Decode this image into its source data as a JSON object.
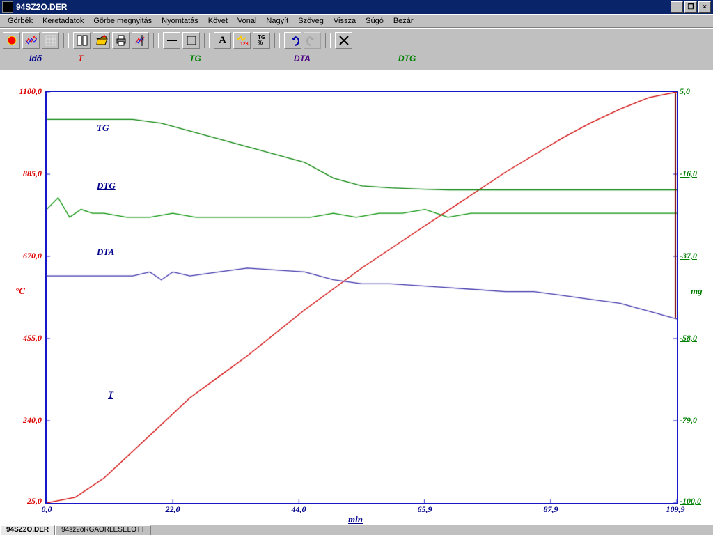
{
  "window": {
    "title": "94SZ2O.DER"
  },
  "menu": [
    "Görbék",
    "Keretadatok",
    "Görbe megnyitás",
    "Nyomtatás",
    "Követ",
    "Vonal",
    "Nagyít",
    "Szöveg",
    "Vissza",
    "Súgó",
    "Bezár"
  ],
  "series_header": {
    "ido": "Idő",
    "t": "T",
    "tg": "TG",
    "dta": "DTA",
    "dtg": "DTG"
  },
  "axis": {
    "left_label": "°C",
    "right_label": "mg",
    "bottom_label": "min",
    "left_ticks": [
      "1100,0",
      "885,0",
      "670,0",
      "455,0",
      "240,0",
      "25,0"
    ],
    "right_ticks": [
      "5,0",
      "-16,0",
      "-37,0",
      "-58,0",
      "-79,0",
      "-100,0"
    ],
    "bottom_ticks": [
      "0,0",
      "22,0",
      "44,0",
      "65,9",
      "87,9",
      "109,9"
    ]
  },
  "series_labels": {
    "tg": "TG",
    "dtg": "DTG",
    "dta": "DTA",
    "t": "T"
  },
  "tabs": [
    "94SZ2O.DER",
    "94sz2oRGAORLESELOTT"
  ],
  "chart_data": {
    "type": "line",
    "xlabel": "min",
    "x_range": [
      0.0,
      109.9
    ],
    "series": [
      {
        "name": "T",
        "axis": "left",
        "ylabel": "°C",
        "ylim": [
          25,
          1100
        ],
        "color": "#d00000",
        "x": [
          0,
          5,
          10,
          15,
          20,
          25,
          30,
          35,
          40,
          45,
          50,
          55,
          60,
          65,
          70,
          75,
          80,
          85,
          90,
          95,
          100,
          105,
          109.9
        ],
        "y": [
          25,
          40,
          90,
          160,
          230,
          300,
          355,
          410,
          470,
          530,
          585,
          640,
          690,
          740,
          790,
          840,
          890,
          935,
          980,
          1020,
          1055,
          1085,
          1100
        ]
      },
      {
        "name": "TG",
        "axis": "right",
        "ylabel": "mg",
        "ylim": [
          -100,
          5
        ],
        "color": "#008000",
        "x": [
          0,
          5,
          10,
          15,
          20,
          25,
          30,
          35,
          40,
          45,
          50,
          55,
          60,
          65,
          70,
          75,
          80,
          85,
          90,
          95,
          100,
          105,
          109.9
        ],
        "y": [
          -2,
          -2,
          -2,
          -2,
          -3,
          -5,
          -7,
          -9,
          -11,
          -13,
          -17,
          -19,
          -19.5,
          -19.8,
          -20,
          -20,
          -20,
          -20,
          -20,
          -20,
          -20,
          -20,
          -20
        ]
      },
      {
        "name": "DTG",
        "axis": "right",
        "ylabel": "mg",
        "ylim": [
          -100,
          5
        ],
        "color": "#009000",
        "x": [
          0,
          2,
          4,
          6,
          8,
          10,
          14,
          18,
          22,
          26,
          30,
          34,
          38,
          42,
          46,
          50,
          54,
          58,
          62,
          66,
          70,
          74,
          78,
          82,
          86,
          90,
          94,
          98,
          102,
          106,
          109.9
        ],
        "y": [
          -25,
          -22,
          -27,
          -25,
          -26,
          -26,
          -27,
          -27,
          -26,
          -27,
          -27,
          -27,
          -27,
          -27,
          -27,
          -26,
          -27,
          -26,
          -26,
          -25,
          -27,
          -26,
          -26,
          -26,
          -26,
          -26,
          -26,
          -26,
          -26,
          -26,
          -26
        ]
      },
      {
        "name": "DTA",
        "axis": "right",
        "ylabel": "mg",
        "ylim": [
          -100,
          5
        ],
        "color": "#3a2fa8",
        "x": [
          0,
          5,
          10,
          15,
          18,
          20,
          22,
          25,
          30,
          35,
          40,
          45,
          50,
          55,
          60,
          65,
          70,
          75,
          80,
          85,
          90,
          95,
          100,
          105,
          109.9
        ],
        "y": [
          -42,
          -42,
          -42,
          -42,
          -41,
          -43,
          -41,
          -42,
          -41,
          -40,
          -40.5,
          -41,
          -43,
          -44,
          -44,
          -44.5,
          -45,
          -45.5,
          -46,
          -46,
          -47,
          -48,
          -49,
          -51,
          -53
        ]
      }
    ]
  }
}
